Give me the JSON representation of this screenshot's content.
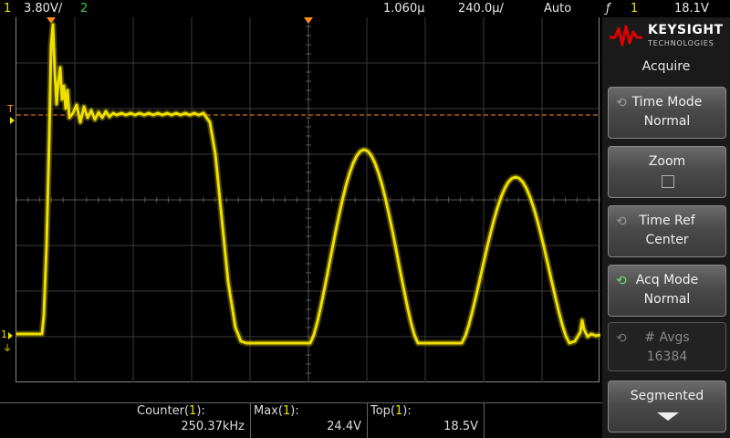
{
  "topbar": {
    "ch1_num": "1",
    "ch1_scale": "3.80V/",
    "ch2_num": "2",
    "time_delay": "1.060µ",
    "time_scale": "240.0µ/",
    "trigger_mode": "Auto",
    "trigger_icon": "trigger-edge-icon",
    "trigger_glyph": "ƒ",
    "trigger_source": "1",
    "trigger_level": "18.1V"
  },
  "screen": {
    "trigger_marker": "T",
    "ch1_marker": "1",
    "trace_color": "#f0e000",
    "trigger_line_color": "#ff8c1a"
  },
  "measurements": [
    {
      "name": "Counter",
      "channel": "1",
      "suffix": ":",
      "value": "250.37kHz"
    },
    {
      "name": "Max",
      "channel": "1",
      "suffix": ":",
      "value": "24.4V"
    },
    {
      "name": "Top",
      "channel": "1",
      "suffix": ":",
      "value": "18.5V"
    }
  ],
  "panel": {
    "brand": "KEYSIGHT",
    "brand_sub": "TECHNOLOGIES",
    "title": "Acquire",
    "softkeys": [
      {
        "line1": "Time Mode",
        "line2": "Normal"
      },
      {
        "line1": "Zoom",
        "line2": ""
      },
      {
        "line1": "Time Ref",
        "line2": "Center"
      },
      {
        "line1": "Acq Mode",
        "line2": "Normal"
      },
      {
        "line1": "# Avgs",
        "line2": "16384"
      },
      {
        "line1": "Segmented",
        "line2": ""
      }
    ]
  },
  "colors": {
    "channel1": "#f0e000",
    "channel2": "#3cc83c",
    "logo_red": "#e00000"
  }
}
